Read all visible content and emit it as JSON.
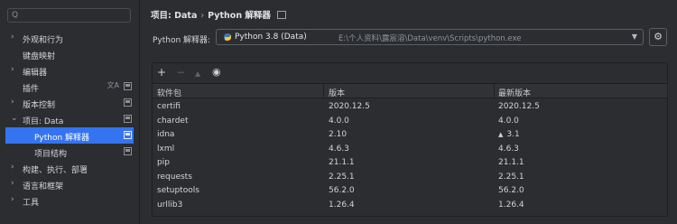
{
  "search": {
    "placeholder": "Q"
  },
  "sidebar": {
    "items": [
      {
        "label": "外观和行为",
        "expandable": true,
        "expanded": false
      },
      {
        "label": "键盘映射",
        "expandable": false
      },
      {
        "label": "编辑器",
        "expandable": true,
        "expanded": false
      },
      {
        "label": "插件",
        "expandable": false
      },
      {
        "label": "版本控制",
        "expandable": true,
        "expanded": false
      },
      {
        "label": "项目: Data",
        "expandable": true,
        "expanded": true
      },
      {
        "label": "Python 解释器",
        "expandable": false,
        "selected": true
      },
      {
        "label": "项目结构",
        "expandable": false
      },
      {
        "label": "构建、执行、部署",
        "expandable": true,
        "expanded": false
      },
      {
        "label": "语言和框架",
        "expandable": true,
        "expanded": false
      },
      {
        "label": "工具",
        "expandable": true,
        "expanded": false
      }
    ]
  },
  "breadcrumb": {
    "part1": "项目: Data",
    "separator": "›",
    "part2": "Python 解释器"
  },
  "interpreter": {
    "label": "Python 解释器:",
    "name": "Python 3.8 (Data)",
    "path": "E:\\个人资料\\露宸溶\\Data\\venv\\Scripts\\python.exe"
  },
  "packages": {
    "headers": [
      "软件包",
      "版本",
      "最新版本"
    ],
    "rows": [
      {
        "name": "certifi",
        "version": "2020.12.5",
        "latest": "2020.12.5",
        "upgrade": false
      },
      {
        "name": "chardet",
        "version": "4.0.0",
        "latest": "4.0.0",
        "upgrade": false
      },
      {
        "name": "idna",
        "version": "2.10",
        "latest": "3.1",
        "upgrade": true
      },
      {
        "name": "lxml",
        "version": "4.6.3",
        "latest": "4.6.3",
        "upgrade": false
      },
      {
        "name": "pip",
        "version": "21.1.1",
        "latest": "21.1.1",
        "upgrade": false
      },
      {
        "name": "requests",
        "version": "2.25.1",
        "latest": "2.25.1",
        "upgrade": false
      },
      {
        "name": "setuptools",
        "version": "56.2.0",
        "latest": "56.2.0",
        "upgrade": false
      },
      {
        "name": "urllib3",
        "version": "1.26.4",
        "latest": "1.26.4",
        "upgrade": false
      }
    ]
  },
  "colors": {
    "background": "#2b2d30",
    "selection": "#3574f0",
    "header": "#303236"
  }
}
